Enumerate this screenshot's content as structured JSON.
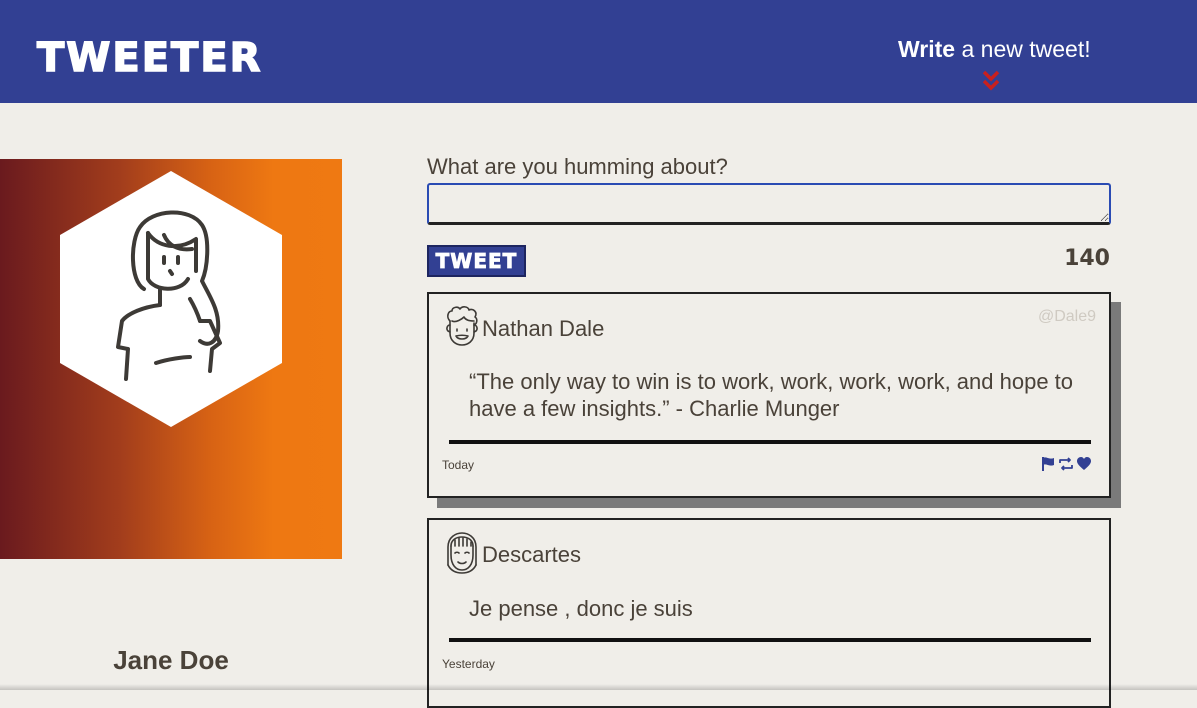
{
  "nav": {
    "brand": "TWEETER",
    "write_bold": "Write",
    "write_rest": " a new tweet!",
    "chevron_icon": "double-chevron-down-icon",
    "background_color": "#324093",
    "accent_color": "#c8201e"
  },
  "profile": {
    "name": "Jane Doe",
    "avatar_icon": "woman-avatar-icon"
  },
  "compose": {
    "prompt": "What are you humming about?",
    "input_value": "",
    "button_label": "TWEET",
    "counter": "140"
  },
  "tweets": [
    {
      "author": "Nathan Dale",
      "handle": "@Dale9",
      "content": "“The only way to win is to work, work, work, work, and hope to have a few insights.” - Charlie Munger",
      "date": "Today",
      "avatar_icon": "curly-hair-man-avatar-icon",
      "actions": [
        "flag-icon",
        "retweet-icon",
        "heart-icon"
      ]
    },
    {
      "author": "Descartes",
      "handle": "",
      "content": "Je pense , donc je suis",
      "date": "Yesterday",
      "avatar_icon": "bangs-avatar-icon",
      "actions": []
    }
  ]
}
